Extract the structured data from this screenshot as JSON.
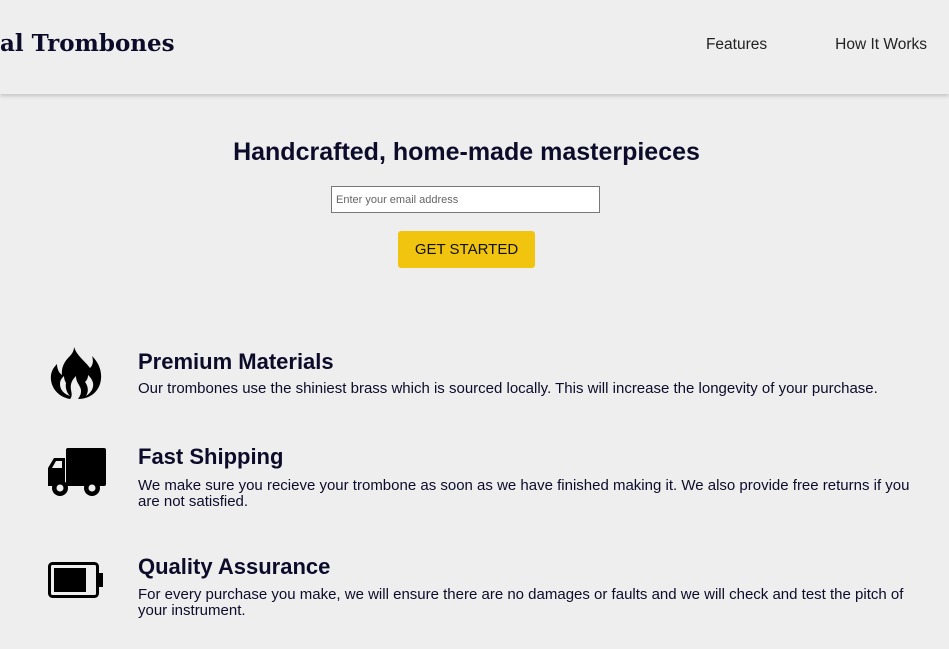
{
  "header": {
    "logo_text": "al Trombones",
    "nav": [
      "Features",
      "How It Works"
    ]
  },
  "hero": {
    "title": "Handcrafted, home-made masterpieces",
    "email_placeholder": "Enter your email address",
    "cta_label": "GET STARTED"
  },
  "features": [
    {
      "icon": "fire-icon",
      "title": "Premium Materials",
      "description": "Our trombones use the shiniest brass which is sourced locally. This will increase the longevity of your purchase."
    },
    {
      "icon": "truck-icon",
      "title": "Fast Shipping",
      "description": "We make sure you recieve your trombone as soon as we have finished making it. We also provide free returns if you are not satisfied."
    },
    {
      "icon": "battery-icon",
      "title": "Quality Assurance",
      "description": "For every purchase you make, we will ensure there are no damages or faults and we will check and test the pitch of your instrument."
    }
  ],
  "colors": {
    "background": "#eeeeee",
    "text": "#0c0c2a",
    "accent": "#f1c40f"
  }
}
